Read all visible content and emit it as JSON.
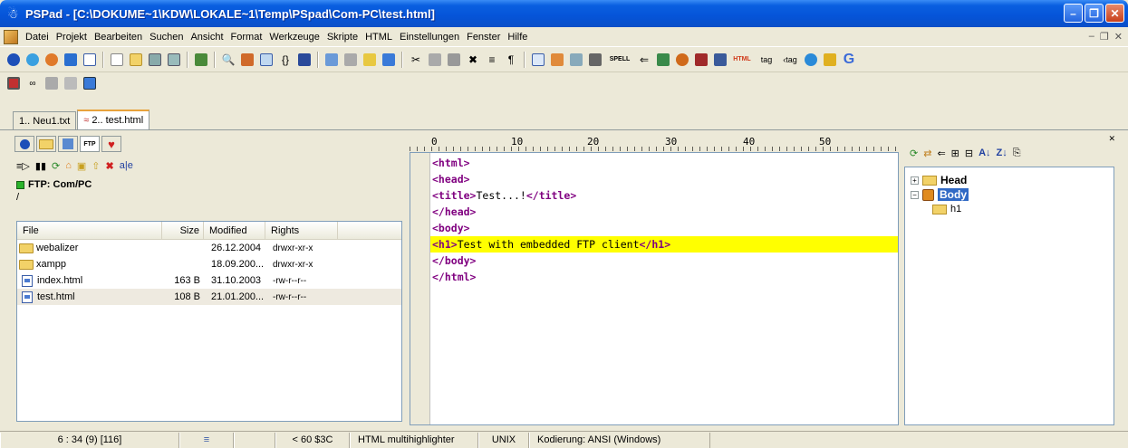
{
  "window": {
    "title": "PSPad - [C:\\DOKUME~1\\KDW\\LOKALE~1\\Temp\\PSpad\\Com-PC\\test.html]",
    "buttons": [
      "minimize",
      "restore",
      "close"
    ]
  },
  "menu": {
    "items": [
      "Datei",
      "Projekt",
      "Bearbeiten",
      "Suchen",
      "Ansicht",
      "Format",
      "Werkzeuge",
      "Skripte",
      "HTML",
      "Einstellungen",
      "Fenster",
      "Hilfe"
    ]
  },
  "toolbar": {
    "icons": [
      "blue-circle",
      "browser",
      "browser-dropdown",
      "ie",
      "log",
      "new",
      "open",
      "save",
      "save-all",
      "project",
      "find",
      "replace",
      "spell-comments",
      "bracket",
      "split",
      "preview",
      "print",
      "highlight",
      "back",
      "cut",
      "copy",
      "paste",
      "delete",
      "format",
      "paragraph",
      "code-explorer",
      "clip",
      "col",
      "lock",
      "spell",
      "bookmark",
      "fold",
      "tidy",
      "ftp",
      "grid",
      "html-txt",
      "tag",
      "tag2",
      "globe",
      "color",
      "g"
    ],
    "spell_label": "SPELL",
    "html_label": "HTML",
    "tag_label": "tag",
    "g_label": "G"
  },
  "toolbar2": {
    "icons": [
      "stop",
      "glasses",
      "gray-1",
      "gray-2",
      "monitor"
    ]
  },
  "doc_tabs": [
    {
      "label": "1.. Neu1.txt",
      "active": false
    },
    {
      "label": "2.. test.html",
      "active": true
    }
  ],
  "left_panel": {
    "tabs": [
      "circle",
      "folder",
      "explorer",
      "FTP",
      "heart"
    ],
    "ftp_tab_label": "FTP",
    "ftp_status": "FTP: Com/PC",
    "path": "/",
    "columns": [
      "File",
      "Size",
      "Modified",
      "Rights"
    ],
    "files": [
      {
        "name": "webalizer",
        "type": "folder",
        "size": "",
        "modified": "26.12.2004",
        "rights": "drwxr-xr-x"
      },
      {
        "name": "xampp",
        "type": "folder",
        "size": "",
        "modified": "18.09.200...",
        "rights": "drwxr-xr-x"
      },
      {
        "name": "index.html",
        "type": "file",
        "size": "163 B",
        "modified": "31.10.2003",
        "rights": "-rw-r--r--"
      },
      {
        "name": "test.html",
        "type": "file",
        "size": "108 B",
        "modified": "21.01.200...",
        "rights": "-rw-r--r--"
      }
    ]
  },
  "ruler": {
    "labels": [
      "0",
      "10",
      "20",
      "30",
      "40",
      "50"
    ]
  },
  "editor": {
    "lines": [
      {
        "tag_open": "<html>",
        "text": "",
        "tag_close": ""
      },
      {
        "tag_open": "<head>",
        "text": "",
        "tag_close": ""
      },
      {
        "tag_open": "<title>",
        "text": "Test...!",
        "tag_close": "</title>"
      },
      {
        "tag_open": "</head>",
        "text": "",
        "tag_close": ""
      },
      {
        "tag_open": "<body>",
        "text": "",
        "tag_close": ""
      },
      {
        "tag_open": "<h1>",
        "text": "Test with embedded FTP client",
        "tag_close": "</h1>"
      },
      {
        "tag_open": "</body>",
        "text": "",
        "tag_close": ""
      },
      {
        "tag_open": "</html>",
        "text": "",
        "tag_close": ""
      }
    ],
    "highlight_line": 5
  },
  "tree": {
    "nodes": [
      {
        "label": "Head",
        "expander": "+",
        "icon": "folder",
        "selected": false,
        "level": 0
      },
      {
        "label": "Body",
        "expander": "-",
        "icon": "cube",
        "selected": true,
        "level": 0
      },
      {
        "label": "h1",
        "expander": "",
        "icon": "folder",
        "selected": false,
        "level": 1
      }
    ]
  },
  "status": {
    "position": "6 : 34  (9)  [116]",
    "char": "< 60 $3C",
    "highlighter": "HTML multihighlighter",
    "line_ending": "UNIX",
    "encoding": "Kodierung: ANSI (Windows)"
  },
  "colors": {
    "title_bar": "#0a5fe0",
    "tag": "#800080",
    "highlight": "#ffff00",
    "selection": "#316ac5"
  }
}
